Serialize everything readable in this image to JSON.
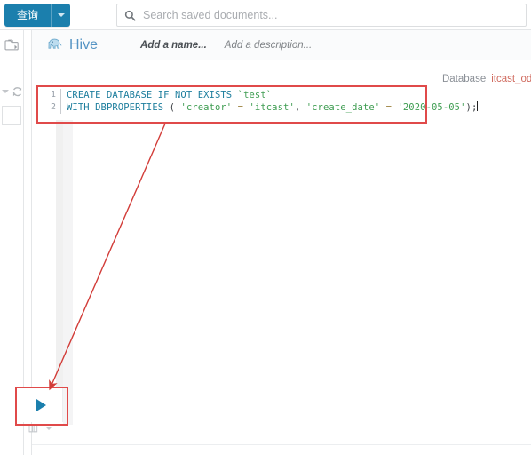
{
  "topbar": {
    "query_button_label": "查询",
    "query_button_caret": "chevron-down-icon",
    "search_placeholder": "Search saved documents...",
    "search_value": "",
    "search_icon": "search-icon"
  },
  "rail": {
    "documents_icon": "documents-folder-icon",
    "refresh_icon": "refresh-icon",
    "refresh_caret": "chevron-down-icon"
  },
  "doc_header": {
    "app_icon": "hive-elephant-icon",
    "app_name": "Hive",
    "name_placeholder": "Add a name...",
    "description_placeholder": "Add a description..."
  },
  "context": {
    "database_label": "Database",
    "database_value": "itcast_od"
  },
  "editor": {
    "lines": [
      {
        "number": "1",
        "tokens": [
          {
            "kind": "kw",
            "text": "CREATE DATABASE IF NOT EXISTS "
          },
          {
            "kind": "str",
            "text": "`test`"
          }
        ]
      },
      {
        "number": "2",
        "tokens": [
          {
            "kind": "kw",
            "text": "WITH DBPROPERTIES "
          },
          {
            "kind": "pl",
            "text": "( "
          },
          {
            "kind": "str",
            "text": "'creator'"
          },
          {
            "kind": "op",
            "text": " = "
          },
          {
            "kind": "str",
            "text": "'itcast'"
          },
          {
            "kind": "pl",
            "text": ", "
          },
          {
            "kind": "str",
            "text": "'create_date'"
          },
          {
            "kind": "op",
            "text": " = "
          },
          {
            "kind": "str",
            "text": "'2020-05-05'"
          },
          {
            "kind": "pl",
            "text": ");"
          }
        ]
      }
    ]
  },
  "actions": {
    "execute_icon": "play-execute-icon",
    "chart_icon": "chart-book-icon",
    "chart_caret": "chevron-down-icon"
  },
  "annotations": {
    "accent_color": "#e04a4a",
    "code_highlight": "highlight-box-around-sql",
    "play_highlight": "highlight-box-around-execute-button",
    "arrow": "arrow-from-sql-to-execute-button"
  },
  "colors": {
    "brand_blue": "#1b7fad",
    "hive_text": "#5594c4",
    "keyword": "#1f7f9e",
    "string": "#3f9d52",
    "db_value": "#d06a5e"
  }
}
